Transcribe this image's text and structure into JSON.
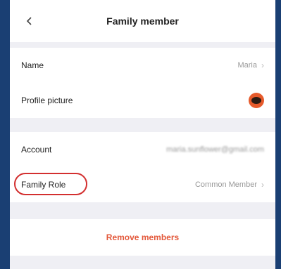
{
  "header": {
    "title": "Family member",
    "back_icon": "chevron-left-icon"
  },
  "profile": {
    "name_label": "Name",
    "name_value": "Maria",
    "picture_label": "Profile picture",
    "avatar_icon": "avatar-eye-icon"
  },
  "account": {
    "account_label": "Account",
    "account_value": "maria.sunflower@gmail.com",
    "role_label": "Family Role",
    "role_value": "Common Member"
  },
  "actions": {
    "remove_label": "Remove members"
  },
  "colors": {
    "accent": "#e3583a",
    "highlight": "#d32f2f",
    "background": "#1a3f73"
  }
}
